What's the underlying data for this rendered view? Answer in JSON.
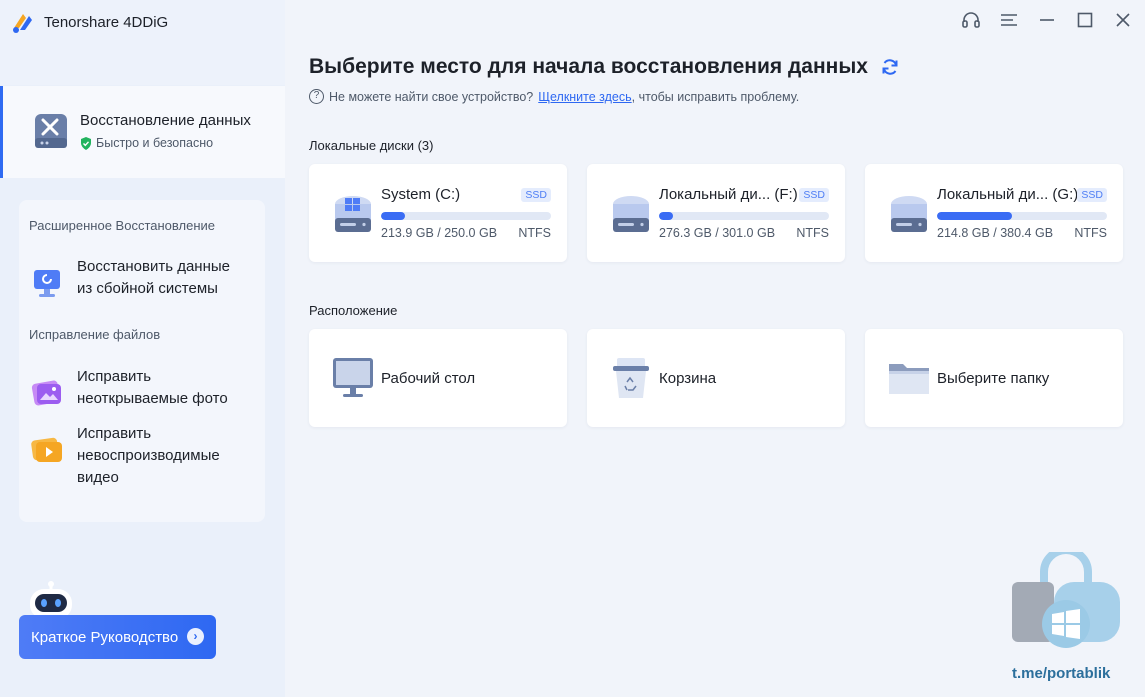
{
  "app": {
    "title": "Tenorshare 4DDiG"
  },
  "sidebar": {
    "active": {
      "label": "Восстановление данных",
      "sub": "Быстро и безопасно"
    },
    "advanced": {
      "section1": "Расширенное Восстановление",
      "item1": {
        "line1": "Восстановить данные",
        "line2": "из сбойной системы"
      },
      "section2": "Исправление файлов",
      "item2": {
        "line1": "Исправить",
        "line2": "неоткрываемые фото"
      },
      "item3": {
        "line1": "Исправить",
        "line2": "невоспроизводимые",
        "line3": "видео"
      }
    },
    "guide_button": "Краткое Руководство"
  },
  "main": {
    "heading": "Выберите место для начала восстановления данных",
    "help": {
      "before": "Не можете найти свое устройство?",
      "link": "Щелкните здесь",
      "after": ", чтобы исправить проблему."
    },
    "local_title": "Локальные диски (3)",
    "disks": [
      {
        "name": "System (C:)",
        "badge": "SSD",
        "size": "213.9 GB / 250.0 GB",
        "fs": "NTFS",
        "used_fraction": 0.14
      },
      {
        "name": "Локальный ди... (F:)",
        "badge": "SSD",
        "size": "276.3 GB / 301.0 GB",
        "fs": "NTFS",
        "used_fraction": 0.08
      },
      {
        "name": "Локальный ди... (G:)",
        "badge": "SSD",
        "size": "214.8 GB / 380.4 GB",
        "fs": "NTFS",
        "used_fraction": 0.44
      }
    ],
    "location_title": "Расположение",
    "locations": [
      {
        "name": "Рабочий стол"
      },
      {
        "name": "Корзина"
      },
      {
        "name": "Выберите папку"
      }
    ]
  },
  "watermark": {
    "text": "t.me/portablik"
  },
  "colors": {
    "accent": "#2e68f2",
    "bar_bg": "#e1e8f5",
    "sidebar_bg": "#eaf0fa"
  }
}
